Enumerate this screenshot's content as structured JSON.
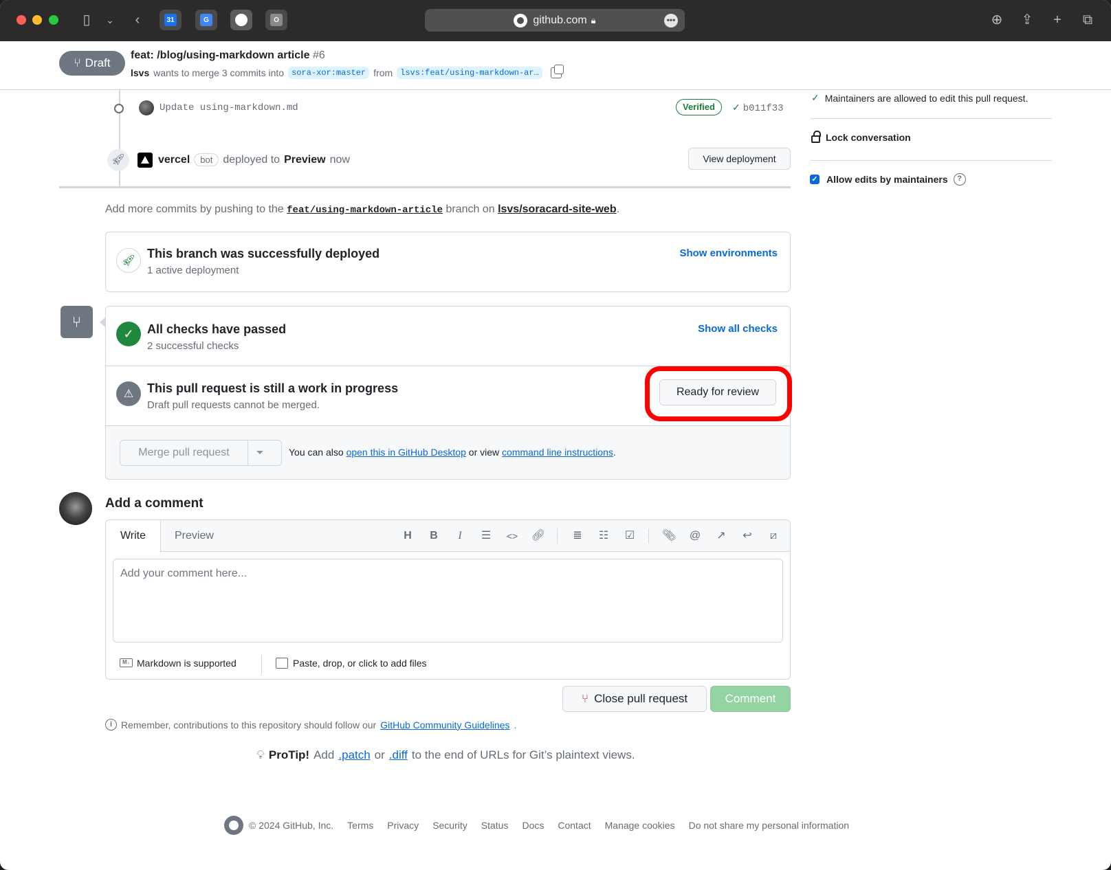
{
  "browser": {
    "url": "github.com",
    "tabs": [
      {
        "name": "calendar",
        "label": "31",
        "color": "#1a73e8"
      },
      {
        "name": "translate",
        "label": "G",
        "color": "#4285f4"
      },
      {
        "name": "github",
        "label": "",
        "color": "#000000"
      },
      {
        "name": "other",
        "label": "O",
        "color": "#8a8a8a"
      }
    ]
  },
  "header": {
    "state": "Draft",
    "title": "feat: /blog/using-markdown article",
    "number": "#6",
    "author": "lsvs",
    "merge_text": "wants to merge 3 commits into",
    "base_branch": "sora-xor:master",
    "from_text": "from",
    "head_branch": "lsvs:feat/using-markdown-ar…"
  },
  "timeline": {
    "commit_message": "Update using-markdown.md",
    "verified_label": "Verified",
    "commit_sha": "b011f33",
    "deploy_actor": "vercel",
    "bot_label": "bot",
    "deploy_text": "deployed to",
    "deploy_env": "Preview",
    "deploy_time": "now",
    "view_deployment_label": "View deployment"
  },
  "add_commits": {
    "prefix": "Add more commits by pushing to the",
    "branch": "feat/using-markdown-article",
    "middle": "branch on",
    "repo": "lsvs/soracard-site-web",
    "suffix": "."
  },
  "deployment": {
    "title": "This branch was successfully deployed",
    "subtitle": "1 active deployment",
    "link": "Show environments"
  },
  "checks": {
    "title": "All checks have passed",
    "subtitle": "2 successful checks",
    "link": "Show all checks"
  },
  "draft_notice": {
    "title": "This pull request is still a work in progress",
    "subtitle": "Draft pull requests cannot be merged.",
    "button": "Ready for review"
  },
  "merge": {
    "button": "Merge pull request",
    "note_prefix": "You can also",
    "desktop_link": "open this in GitHub Desktop",
    "note_middle": "or view",
    "cli_link": "command line instructions",
    "note_suffix": "."
  },
  "comment": {
    "heading": "Add a comment",
    "tab_write": "Write",
    "tab_preview": "Preview",
    "placeholder": "Add your comment here...",
    "markdown_note": "Markdown is supported",
    "files_note": "Paste, drop, or click to add files",
    "close_button": "Close pull request",
    "comment_button": "Comment"
  },
  "remember": {
    "text": "Remember, contributions to this repository should follow our",
    "link": "GitHub Community Guidelines",
    "suffix": "."
  },
  "protip": {
    "label": "ProTip!",
    "text1": "Add",
    "patch": ".patch",
    "or": "or",
    "diff": ".diff",
    "text2": "to the end of URLs for Git’s plaintext views."
  },
  "footer": {
    "copyright": "© 2024 GitHub, Inc.",
    "links": [
      "Terms",
      "Privacy",
      "Security",
      "Status",
      "Docs",
      "Contact",
      "Manage cookies",
      "Do not share my personal information"
    ]
  },
  "sidebar": {
    "maintainers_note": "Maintainers are allowed to edit this pull request.",
    "lock": "Lock conversation",
    "allow_edits": "Allow edits by maintainers"
  }
}
